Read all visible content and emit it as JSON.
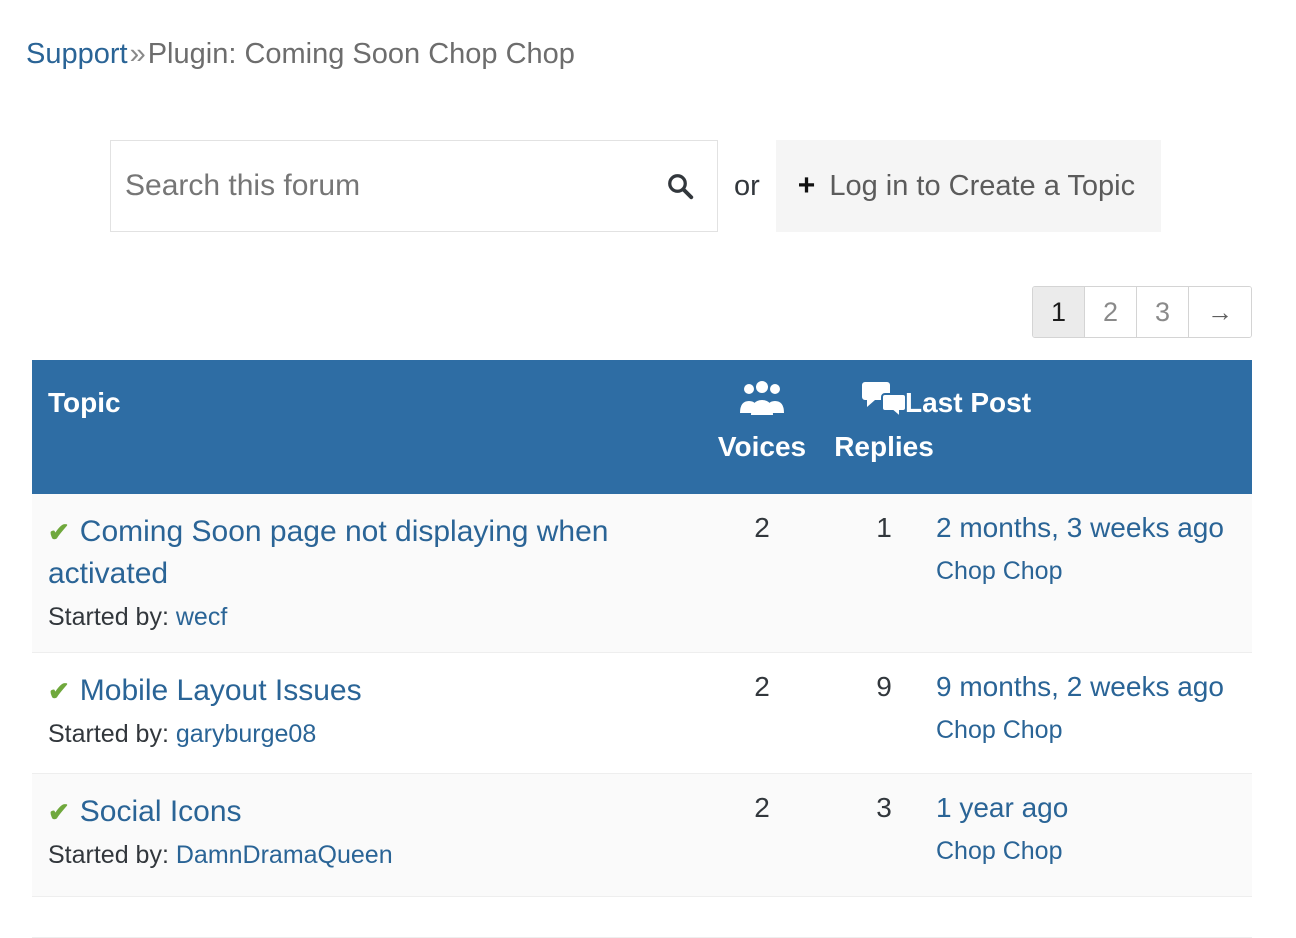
{
  "breadcrumb": {
    "root_label": "Support",
    "separator": "»",
    "current_label": "Plugin: Coming Soon Chop Chop"
  },
  "search": {
    "placeholder": "Search this forum",
    "value": "",
    "icon": "search-icon"
  },
  "actions": {
    "or_label": "or",
    "create_topic_label": "Log in to Create a Topic",
    "plus_icon": "+"
  },
  "pagination": {
    "pages": [
      "1",
      "2",
      "3"
    ],
    "active_page": "1",
    "next_label": "→"
  },
  "table": {
    "headers": {
      "topic": "Topic",
      "voices": "Voices",
      "replies": "Replies",
      "last_post": "Last Post",
      "voices_icon": "users-group-icon",
      "replies_icon": "speech-bubbles-icon"
    },
    "rows": [
      {
        "status_icon": "✔",
        "title": "Coming Soon page not displaying when activated",
        "started_by_label": "Started by:",
        "author": "wecf",
        "voices": "2",
        "replies": "1",
        "last_post_time": "2 months, 3 weeks ago",
        "last_post_author": "Chop Chop"
      },
      {
        "status_icon": "✔",
        "title": "Mobile Layout Issues",
        "started_by_label": "Started by:",
        "author": "garyburge08",
        "voices": "2",
        "replies": "9",
        "last_post_time": "9 months, 2 weeks ago",
        "last_post_author": "Chop Chop"
      },
      {
        "status_icon": "✔",
        "title": "Social Icons",
        "started_by_label": "Started by:",
        "author": "DamnDramaQueen",
        "voices": "2",
        "replies": "3",
        "last_post_time": "1 year ago",
        "last_post_author": "Chop Chop"
      }
    ]
  },
  "colors": {
    "header_blue": "#2e6da4",
    "link_blue": "#2a6496",
    "check_green": "#6fa83c",
    "row_alt": "#fafafa",
    "button_gray": "#f5f5f5"
  }
}
